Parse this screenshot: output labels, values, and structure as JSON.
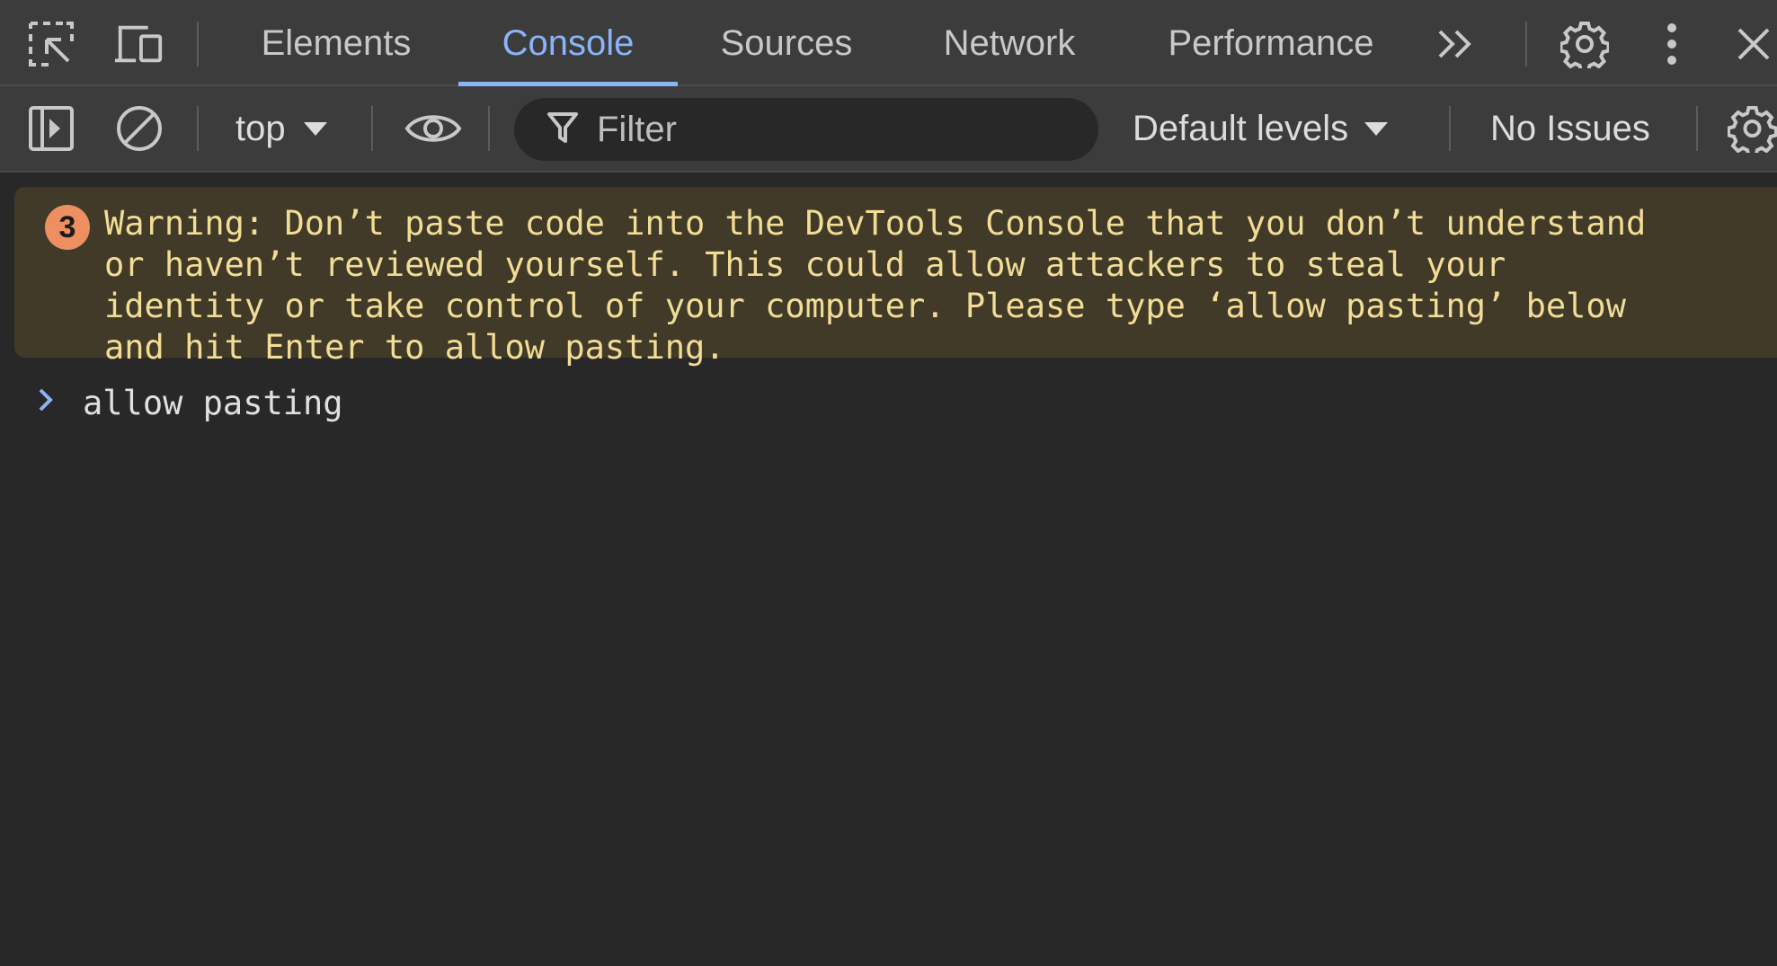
{
  "tabbar": {
    "tabs": [
      {
        "label": "Elements",
        "active": false
      },
      {
        "label": "Console",
        "active": true
      },
      {
        "label": "Sources",
        "active": false
      },
      {
        "label": "Network",
        "active": false
      },
      {
        "label": "Performance",
        "active": false
      }
    ],
    "icons": [
      "inspect-element-icon",
      "device-toolbar-icon",
      "more-tabs-icon",
      "settings-icon",
      "kebab-menu-icon",
      "close-icon"
    ]
  },
  "toolbar": {
    "context": "top",
    "filter_placeholder": "Filter",
    "levels_label": "Default levels",
    "issues_label": "No Issues",
    "icons": [
      "sidebar-toggle-icon",
      "clear-console-icon",
      "live-expression-eye-icon",
      "filter-funnel-icon",
      "console-settings-icon"
    ]
  },
  "console": {
    "warning": {
      "count": "3",
      "text": "Warning: Don’t paste code into the DevTools Console that you don’t understand\nor haven’t reviewed yourself. This could allow attackers to steal your\nidentity or take control of your computer. Please type ‘allow pasting’ below\nand hit Enter to allow pasting."
    },
    "input": "allow pasting"
  },
  "colors": {
    "panel_bg": "#282828",
    "toolbar_bg": "#3c3c3c",
    "accent": "#8ab4f8",
    "warning_bg": "#413a29",
    "warning_text": "#f2dd95",
    "warning_badge": "#ee8f62"
  }
}
